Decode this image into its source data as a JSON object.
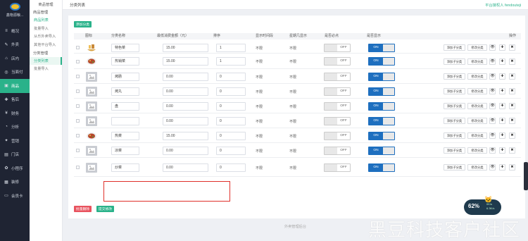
{
  "brand": {
    "name": "鑫物源粮..."
  },
  "main_nav": [
    {
      "icon": "≡",
      "label": "概况"
    },
    {
      "icon": "✎",
      "label": "外卖"
    },
    {
      "icon": "⌂",
      "label": "店内"
    },
    {
      "icon": "◎",
      "label": "当面付"
    },
    {
      "icon": "▣",
      "label": "商品"
    },
    {
      "icon": "✚",
      "label": "售后"
    },
    {
      "icon": "¥",
      "label": "财务"
    },
    {
      "icon": "◔",
      "label": "分析"
    },
    {
      "icon": "✦",
      "label": "营销"
    },
    {
      "icon": "▤",
      "label": "门店"
    },
    {
      "icon": "✿",
      "label": "小程序"
    },
    {
      "icon": "▦",
      "label": "装修"
    },
    {
      "icon": "▭",
      "label": "会员卡"
    }
  ],
  "sub_nav": {
    "top": "商品管理",
    "group1": "商品管理",
    "items1": [
      "商品列表",
      "批量导入",
      "从乐外卖导入",
      "其他平台导入"
    ],
    "group2": "分类管理",
    "items2": [
      "分类列表",
      "批量导入"
    ]
  },
  "topbar": {
    "title": "分类列表",
    "user": "平台授权人 fendouteji"
  },
  "buttons": {
    "add": "添加分类",
    "batch_delete": "批量删除",
    "submit": "提交修改"
  },
  "columns": [
    "图标",
    "分类名称",
    "最低消费金额（元）",
    "排序",
    "显示时间段",
    "星期几显示",
    "是否必点",
    "是否显示",
    "操作"
  ],
  "rows": [
    {
      "icon": "food-noodle",
      "name": "特色菜",
      "min": "15.00",
      "sort": "1",
      "time": "不限",
      "week": "不限",
      "required": "OFF",
      "visible": "ON"
    },
    {
      "icon": "food-dish",
      "name": "热销菜",
      "min": "15.00",
      "sort": "1",
      "time": "不限",
      "week": "不限",
      "required": "OFF",
      "visible": "ON"
    },
    {
      "icon": "placeholder",
      "name": "烤肠",
      "min": "0.00",
      "sort": "0",
      "time": "不限",
      "week": "不限",
      "required": "OFF",
      "visible": "ON"
    },
    {
      "icon": "placeholder",
      "name": "烤丸",
      "min": "0.00",
      "sort": "0",
      "time": "不限",
      "week": "不限",
      "required": "OFF",
      "visible": "ON"
    },
    {
      "icon": "placeholder",
      "name": "盘",
      "min": "0.00",
      "sort": "0",
      "time": "不限",
      "week": "不限",
      "required": "OFF",
      "visible": "ON"
    },
    {
      "icon": "placeholder",
      "name": "",
      "min": "0.00",
      "sort": "0",
      "time": "不限",
      "week": "不限",
      "required": "OFF",
      "visible": "ON"
    },
    {
      "icon": "food-dish",
      "name": "热菜",
      "min": "15.00",
      "sort": "0",
      "time": "不限",
      "week": "不限",
      "required": "OFF",
      "visible": "ON"
    },
    {
      "icon": "placeholder",
      "name": "凉菜",
      "min": "0.00",
      "sort": "0",
      "time": "不限",
      "week": "不限",
      "required": "OFF",
      "visible": "ON"
    },
    {
      "icon": "placeholder",
      "name": "炒菜",
      "min": "0.00",
      "sort": "0",
      "time": "不限",
      "week": "不限",
      "required": "OFF",
      "visible": "ON"
    }
  ],
  "row_actions": {
    "add_child": "添加子分类",
    "edit": "修改分类",
    "view": "👁",
    "up": "✚",
    "delete": "✖"
  },
  "footer": "外卖管理后台",
  "watermark": "黑豆科技客户社区",
  "perf": {
    "pct": "62%",
    "up": "0K/s",
    "down": "6.3K/s"
  },
  "colors": {
    "primary": "#2ab28a",
    "toggle_on": "#1e6fbf",
    "danger": "#e8535f",
    "highlight": "#e0302a"
  }
}
